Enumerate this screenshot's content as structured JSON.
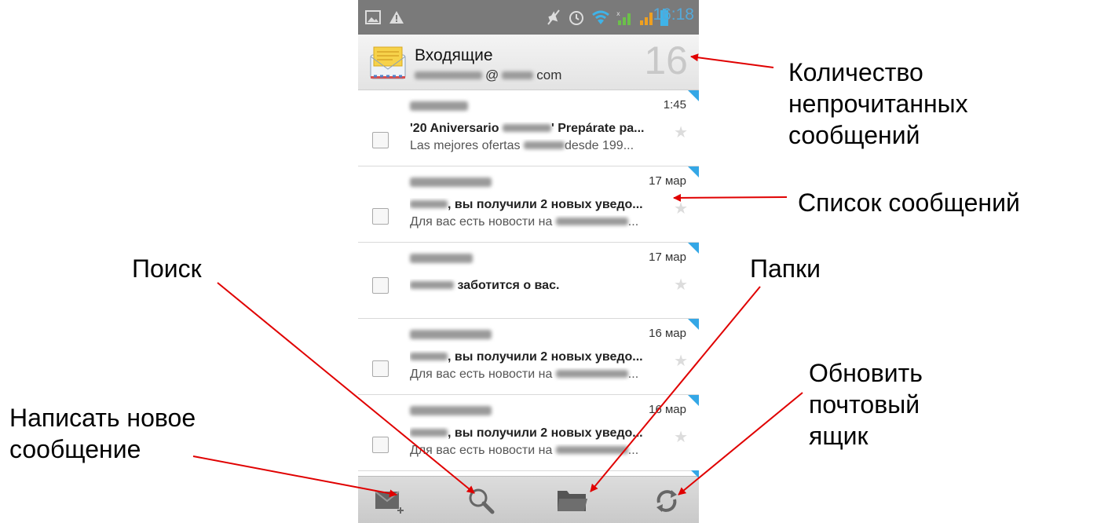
{
  "status_bar": {
    "time": "16:18",
    "icons": [
      "gallery-icon",
      "warning-icon",
      "mute-icon",
      "alarm-icon",
      "wifi-icon",
      "signal-icon",
      "signal-icon",
      "battery-icon"
    ]
  },
  "header": {
    "folder": "Входящие",
    "account_at": "@",
    "account_domain": "com",
    "unread_count": "16"
  },
  "messages": [
    {
      "time": "1:45",
      "subject_a": "'20 Aniversario ",
      "subject_b": "' Prepárate pa...",
      "preview_a": "Las mejores ofertas ",
      "preview_b": "desde 199..."
    },
    {
      "time": "17 мар",
      "subject_a": "",
      "subject_b": ", вы получили 2 новых уведо...",
      "preview_a": "Для вас есть новости на ",
      "preview_b": "..."
    },
    {
      "time": "17 мар",
      "subject_a": "",
      "subject_b": " заботится о вас.",
      "preview_a": "",
      "preview_b": ""
    },
    {
      "time": "16 мар",
      "subject_a": "",
      "subject_b": ", вы получили 2 новых уведо...",
      "preview_a": "Для вас есть новости на ",
      "preview_b": "..."
    },
    {
      "time": "16 мар",
      "subject_a": "",
      "subject_b": ", вы получили 2 новых уведо...",
      "preview_a": "Для вас есть новости на ",
      "preview_b": "..."
    }
  ],
  "bottom_bar": {
    "buttons": [
      "compose-icon",
      "search-icon",
      "folder-icon",
      "refresh-icon"
    ]
  },
  "annotations": {
    "unread_line1": "Количество",
    "unread_line2": "непрочитанных",
    "unread_line3": "сообщений",
    "list": "Список сообщений",
    "search": "Поиск",
    "folders": "Папки",
    "refresh_line1": "Обновить",
    "refresh_line2": "почтовый",
    "refresh_line3": "ящик",
    "compose_line1": "Написать новое",
    "compose_line2": "сообщение"
  },
  "colors": {
    "status_bar": "#7a7a7a",
    "time": "#55a8d8",
    "unread_flag": "#34a7e6",
    "arrow": "#e00000"
  }
}
